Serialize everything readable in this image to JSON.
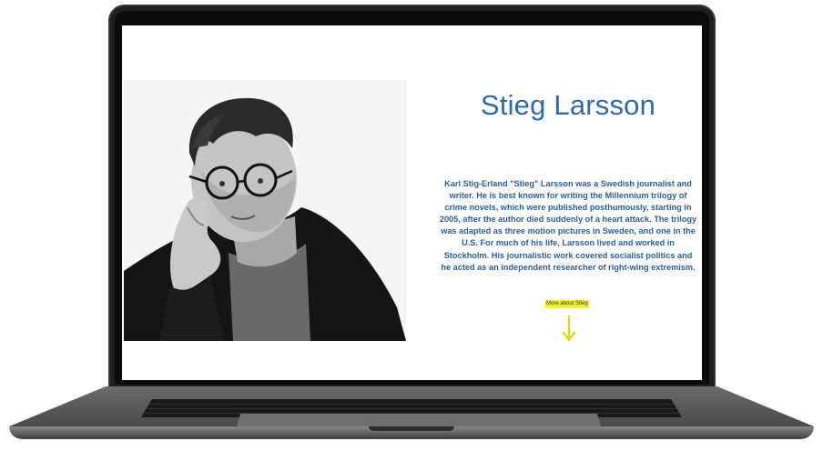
{
  "profile": {
    "name": "Stieg Larsson",
    "bio": "Karl Stig-Erland \"Stieg\" Larsson was a Swedish journalist and writer. He is best known for writing the Millennium trilogy of crime novels, which were published posthumously, starting in 2005, after the author died suddenly of a heart attack. The trilogy was adapted as three motion pictures in Sweden, and one in the U.S. For much of his life, Larsson lived and worked in Stockholm. His journalistic work covered socialist politics and he acted as an independent researcher of right-wing extremism.",
    "more_link_label": "More about Stieg",
    "photo_alt": "Stieg Larsson portrait"
  },
  "icons": {
    "scroll": "arrow-down-icon"
  },
  "colors": {
    "accent": "#2f6aa8",
    "highlight": "#f2f02a",
    "arrow": "#e8d21a"
  }
}
